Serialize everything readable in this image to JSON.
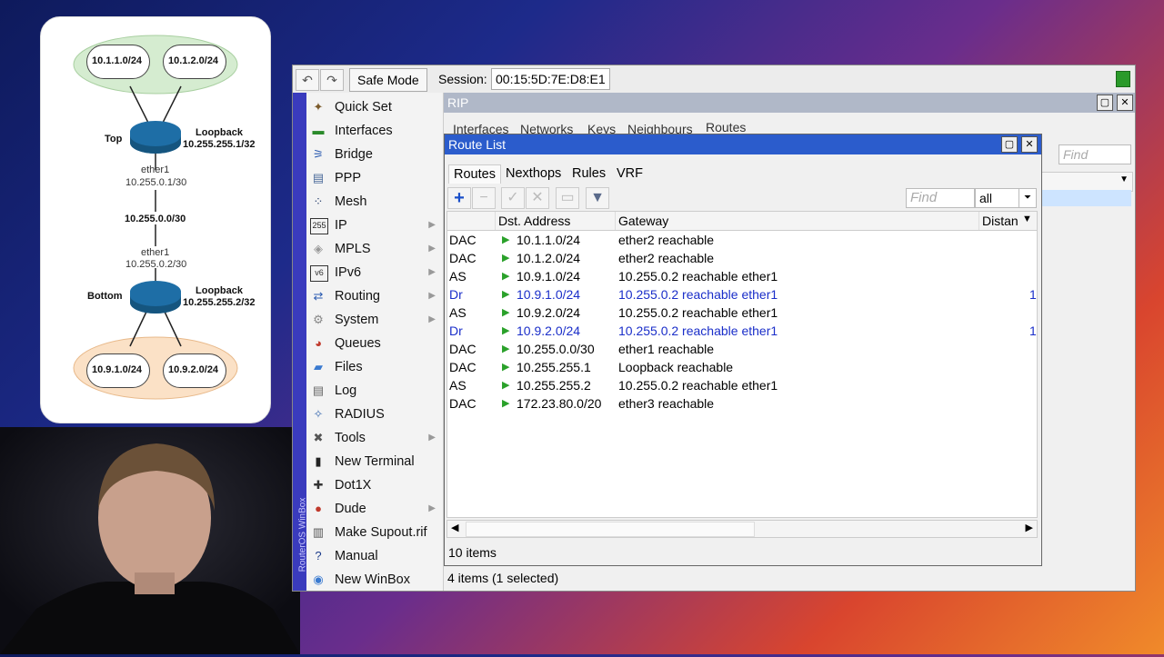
{
  "diagram": {
    "networks_top": [
      "10.1.1.0/24",
      "10.1.2.0/24"
    ],
    "networks_bottom": [
      "10.9.1.0/24",
      "10.9.2.0/24"
    ],
    "top_router": {
      "name": "Top",
      "loopback_label": "Loopback",
      "loopback_ip": "10.255.255.1/32",
      "iface": "ether1",
      "iface_ip": "10.255.0.1/30"
    },
    "link_net": "10.255.0.0/30",
    "bottom_router": {
      "name": "Bottom",
      "loopback_label": "Loopback",
      "loopback_ip": "10.255.255.2/32",
      "iface": "ether1",
      "iface_ip": "10.255.0.2/30"
    }
  },
  "winbox": {
    "safe_mode": "Safe Mode",
    "session_label": "Session:",
    "session_value": "00:15:5D:7E:D8:E1",
    "vertical_label": "RouterOS WinBox",
    "menu": [
      {
        "label": "Quick Set",
        "icon": "wand-icon",
        "arrow": false
      },
      {
        "label": "Interfaces",
        "icon": "interfaces-icon",
        "arrow": false
      },
      {
        "label": "Bridge",
        "icon": "bridge-icon",
        "arrow": false
      },
      {
        "label": "PPP",
        "icon": "ppp-icon",
        "arrow": false
      },
      {
        "label": "Mesh",
        "icon": "mesh-icon",
        "arrow": false
      },
      {
        "label": "IP",
        "icon": "ip-icon",
        "arrow": true
      },
      {
        "label": "MPLS",
        "icon": "mpls-icon",
        "arrow": true
      },
      {
        "label": "IPv6",
        "icon": "ipv6-icon",
        "arrow": true
      },
      {
        "label": "Routing",
        "icon": "routing-icon",
        "arrow": true
      },
      {
        "label": "System",
        "icon": "gear-icon",
        "arrow": true
      },
      {
        "label": "Queues",
        "icon": "queues-icon",
        "arrow": false
      },
      {
        "label": "Files",
        "icon": "folder-icon",
        "arrow": false
      },
      {
        "label": "Log",
        "icon": "log-icon",
        "arrow": false
      },
      {
        "label": "RADIUS",
        "icon": "radius-icon",
        "arrow": false
      },
      {
        "label": "Tools",
        "icon": "tools-icon",
        "arrow": true
      },
      {
        "label": "New Terminal",
        "icon": "terminal-icon",
        "arrow": false
      },
      {
        "label": "Dot1X",
        "icon": "dot1x-icon",
        "arrow": false
      },
      {
        "label": "Dude",
        "icon": "dude-icon",
        "arrow": true
      },
      {
        "label": "Make Supout.rif",
        "icon": "supout-icon",
        "arrow": false
      },
      {
        "label": "Manual",
        "icon": "manual-icon",
        "arrow": false
      },
      {
        "label": "New WinBox",
        "icon": "winbox-icon",
        "arrow": false
      }
    ],
    "rip": {
      "title": "RIP",
      "tabs": [
        "Interfaces",
        "Networks",
        "Keys",
        "Neighbours",
        "Routes"
      ],
      "find": "Find",
      "status": "4 items (1 selected)"
    },
    "route_list": {
      "title": "Route List",
      "tabs": [
        "Routes",
        "Nexthops",
        "Rules",
        "VRF"
      ],
      "find": "Find",
      "filter": "all",
      "columns": [
        "Dst. Address",
        "Gateway",
        "Distan"
      ],
      "rows": [
        {
          "flags": "DAC",
          "dst": "10.1.1.0/24",
          "gateway": "ether2 reachable",
          "dist": "",
          "dyn": false
        },
        {
          "flags": "DAC",
          "dst": "10.1.2.0/24",
          "gateway": "ether2 reachable",
          "dist": "",
          "dyn": false
        },
        {
          "flags": "AS",
          "dst": "10.9.1.0/24",
          "gateway": "10.255.0.2 reachable ether1",
          "dist": "",
          "dyn": false
        },
        {
          "flags": "Dr",
          "dst": "10.9.1.0/24",
          "gateway": "10.255.0.2 reachable ether1",
          "dist": "1",
          "dyn": true
        },
        {
          "flags": "AS",
          "dst": "10.9.2.0/24",
          "gateway": "10.255.0.2 reachable ether1",
          "dist": "",
          "dyn": false
        },
        {
          "flags": "Dr",
          "dst": "10.9.2.0/24",
          "gateway": "10.255.0.2 reachable ether1",
          "dist": "1",
          "dyn": true
        },
        {
          "flags": "DAC",
          "dst": "10.255.0.0/30",
          "gateway": "ether1 reachable",
          "dist": "",
          "dyn": false
        },
        {
          "flags": "DAC",
          "dst": "10.255.255.1",
          "gateway": "Loopback reachable",
          "dist": "",
          "dyn": false
        },
        {
          "flags": "AS",
          "dst": "10.255.255.2",
          "gateway": "10.255.0.2 reachable ether1",
          "dist": "",
          "dyn": false
        },
        {
          "flags": "DAC",
          "dst": "172.23.80.0/20",
          "gateway": "ether3 reachable",
          "dist": "",
          "dyn": false
        }
      ],
      "status": "10 items"
    }
  },
  "colors": {
    "title_active": "#2b5ccc",
    "dynamic_row": "#1a2ec9",
    "play": "#2aa12a"
  }
}
